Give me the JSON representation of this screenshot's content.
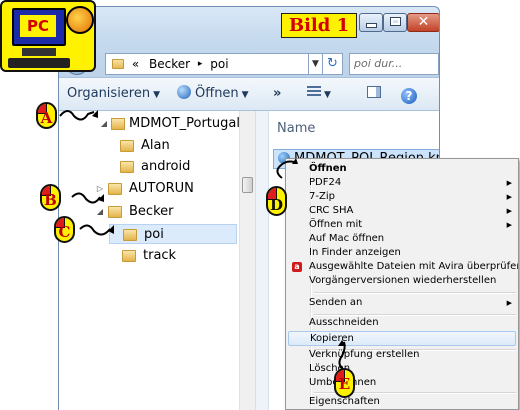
{
  "figure_label": "Bild 1",
  "logo": {
    "text": "PC"
  },
  "window": {
    "address": {
      "chevron": "«",
      "crumbs": [
        "Becker",
        "poi"
      ],
      "separator": "▸"
    },
    "search_placeholder": "poi dur..."
  },
  "toolbar": {
    "organize": "Organisieren",
    "open": "Öffnen",
    "more": "»"
  },
  "nav_tree": [
    {
      "label": "MDMOT_Portugal F:",
      "expander": "◢",
      "indent": 0
    },
    {
      "label": "Alan",
      "expander": "",
      "indent": 1
    },
    {
      "label": "android",
      "expander": "",
      "indent": 1
    },
    {
      "label": "AUTORUN",
      "expander": "▷",
      "indent": 1
    },
    {
      "label": "Becker",
      "expander": "◢",
      "indent": 1
    },
    {
      "label": "poi",
      "expander": "",
      "indent": 2,
      "selected": true
    },
    {
      "label": "track",
      "expander": "",
      "indent": 2
    }
  ],
  "file_list": {
    "column_header": "Name",
    "files": [
      {
        "name": "MDMOT_POI_Region.km"
      }
    ]
  },
  "context_menu": {
    "items": [
      {
        "label": "Öffnen",
        "bold": true
      },
      {
        "label": "PDF24",
        "submenu": true
      },
      {
        "label": "7-Zip",
        "submenu": true
      },
      {
        "label": "CRC SHA",
        "submenu": true
      },
      {
        "label": "Öffnen mit",
        "submenu": true
      },
      {
        "label": "Auf Mac öffnen"
      },
      {
        "label": "In Finder anzeigen"
      },
      {
        "label": "Ausgewählte Dateien mit Avira überprüfen",
        "icon": "avira-icon"
      },
      {
        "label": "Vorgängerversionen wiederherstellen"
      },
      {
        "separator": true
      },
      {
        "label": "Senden an",
        "submenu": true
      },
      {
        "separator": true
      },
      {
        "label": "Ausschneiden"
      },
      {
        "label": "Kopieren",
        "highlight": true
      },
      {
        "separator": true
      },
      {
        "label": "Verknüpfung erstellen"
      },
      {
        "label": "Löschen"
      },
      {
        "label": "Umbenennen"
      },
      {
        "separator": true
      },
      {
        "label": "Eigenschaften"
      }
    ]
  },
  "callouts": [
    "A",
    "B",
    "C",
    "D",
    "E"
  ],
  "colors": {
    "callout_fill": "#fff200",
    "callout_accent": "#e11c1c",
    "figure_label_text": "#d40000"
  }
}
